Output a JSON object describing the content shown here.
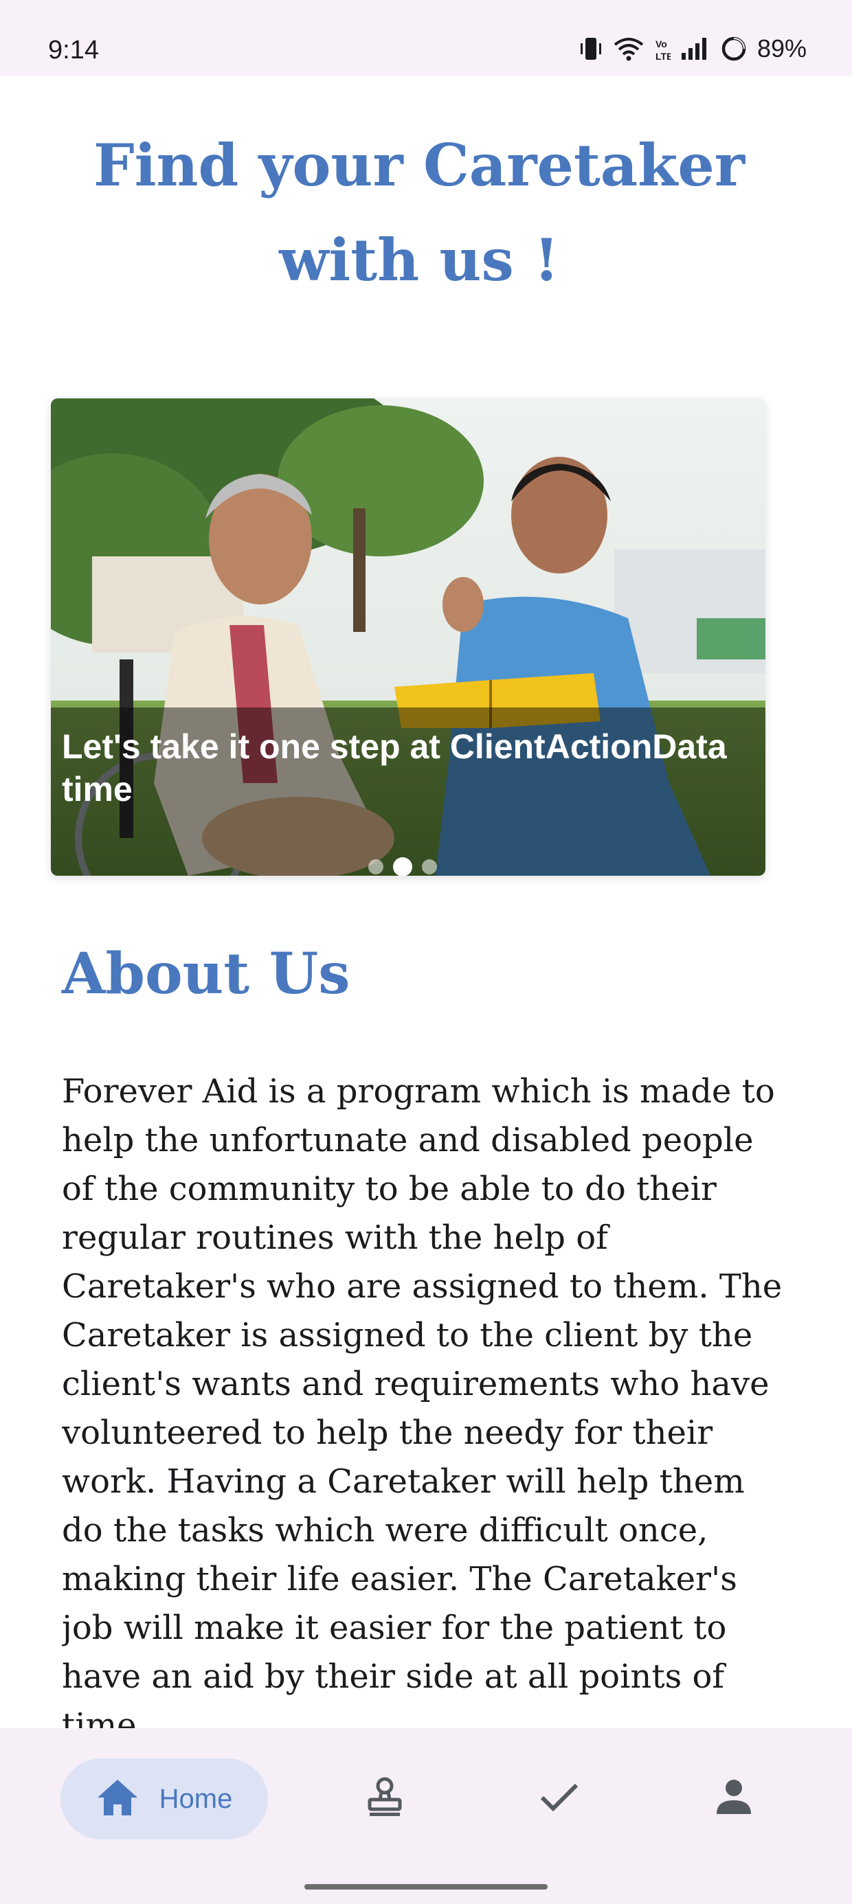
{
  "status_bar": {
    "time": "9:14",
    "battery_percent": "89%",
    "icons": [
      "vibrate-icon",
      "wifi-icon",
      "volte-icon",
      "signal-icon",
      "battery-icon"
    ]
  },
  "headline": "Find your Caretaker with us !",
  "carousel": {
    "caption": "Let's take it one step at ClientActionData time",
    "image": "caretaker-reading-with-elderly-woman-photo",
    "slide_count": 3,
    "active_slide": 2
  },
  "about": {
    "title": "About Us",
    "body": "Forever Aid is a program which is made to help the unfortunate and disabled people of the community to be able to do their regular routines with the help of Caretaker's who are assigned to them. The Caretaker is assigned to the client by the client's wants and requirements who have volunteered to help the needy for their work. Having a Caretaker will help them do the tasks which were difficult once, making their life easier. The Caretaker's job will make it easier for the patient to have an aid by their side at all points of time."
  },
  "bottom_nav": {
    "items": [
      {
        "label": "Home",
        "icon": "home-icon",
        "selected": true
      },
      {
        "label": "",
        "icon": "stamp-icon",
        "selected": false
      },
      {
        "label": "",
        "icon": "check-icon",
        "selected": false
      },
      {
        "label": "",
        "icon": "person-icon",
        "selected": false
      }
    ]
  },
  "colors": {
    "accent": "#4a78be",
    "nav_background": "#f6eff7",
    "nav_selected_pill": "#dde3f5",
    "status_bar_background": "#f8f1f9"
  }
}
